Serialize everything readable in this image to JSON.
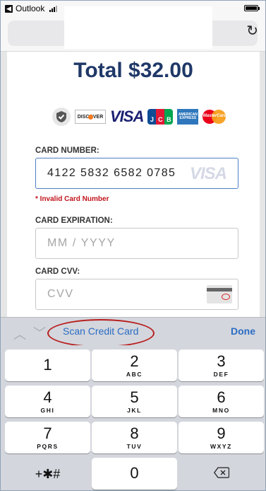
{
  "status_bar": {
    "back_app": "Outlook",
    "back_glyph": "◀"
  },
  "browser": {
    "reload_icon": "reload-icon"
  },
  "checkout": {
    "total": "Total $32.00",
    "brands": {
      "discover": "DISCOVER",
      "visa": "VISA",
      "jcb": [
        "J",
        "C",
        "B"
      ],
      "amex": "AMERICAN EXPRESS",
      "mastercard": "MasterCard"
    },
    "card_number": {
      "label": "CARD NUMBER:",
      "value": "4122 5832 6582 0785",
      "brand_hint": "VISA",
      "error": "* Invalid Card Number"
    },
    "expiration": {
      "label": "CARD EXPIRATION:",
      "placeholder": "MM / YYYY"
    },
    "cvv": {
      "label": "CARD CVV:",
      "placeholder": "CVV"
    }
  },
  "keyboard_toolbar": {
    "prev_glyph": "︿",
    "next_glyph": "﹀",
    "scan_label": "Scan Credit Card",
    "done_label": "Done"
  },
  "keypad": {
    "keys": [
      {
        "num": "1",
        "letters": ""
      },
      {
        "num": "2",
        "letters": "ABC"
      },
      {
        "num": "3",
        "letters": "DEF"
      },
      {
        "num": "4",
        "letters": "GHI"
      },
      {
        "num": "5",
        "letters": "JKL"
      },
      {
        "num": "6",
        "letters": "MNO"
      },
      {
        "num": "7",
        "letters": "PQRS"
      },
      {
        "num": "8",
        "letters": "TUV"
      },
      {
        "num": "9",
        "letters": "WXYZ"
      }
    ],
    "symbols": "+✱#",
    "zero": "0",
    "delete_icon": "delete-icon"
  },
  "colors": {
    "total_text": "#1f3868",
    "link_blue": "#2a6cc4",
    "error_red": "#c0131b",
    "annotation_red": "#b81c1c",
    "active_border": "#4a7fc1"
  }
}
